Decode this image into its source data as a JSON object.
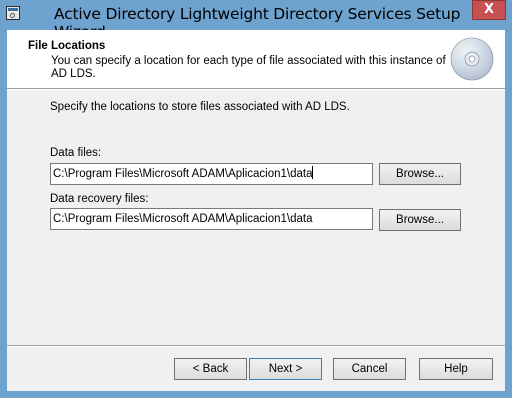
{
  "window": {
    "title": "Active Directory Lightweight Directory Services Setup Wizard",
    "close_glyph": "X"
  },
  "header": {
    "title": "File Locations",
    "description": "You can specify a location for each type of file associated with this instance of AD LDS."
  },
  "body": {
    "intro": "Specify the locations to store files associated with AD LDS.",
    "data_files": {
      "label": "Data files:",
      "value": "C:\\Program Files\\Microsoft ADAM\\Aplicacion1\\data",
      "browse_label": "Browse..."
    },
    "data_recovery_files": {
      "label": "Data recovery files:",
      "value": "C:\\Program Files\\Microsoft ADAM\\Aplicacion1\\data",
      "browse_label": "Browse..."
    }
  },
  "footer": {
    "back_label": "< Back",
    "next_label": "Next >",
    "cancel_label": "Cancel",
    "help_label": "Help"
  },
  "icons": {
    "app": "ad-lds-setup-icon",
    "header": "cd-disc-icon",
    "close": "close-icon"
  }
}
